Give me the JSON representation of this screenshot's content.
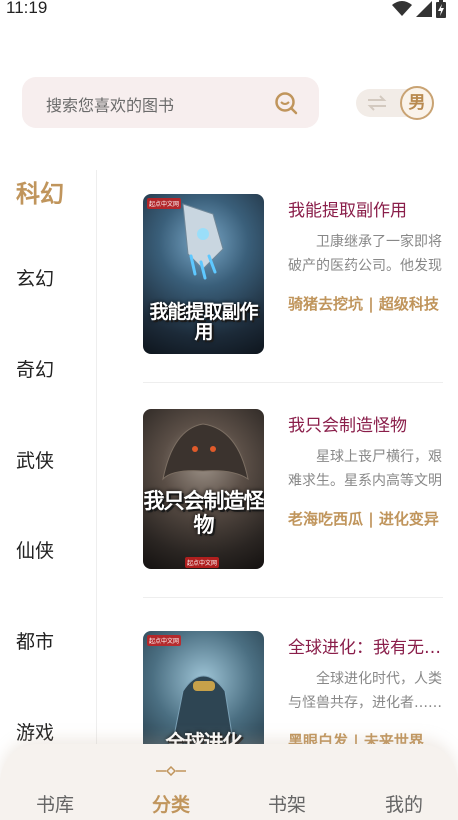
{
  "status": {
    "time": "11:19"
  },
  "search": {
    "placeholder": "搜索您喜欢的图书"
  },
  "gender": {
    "label": "男"
  },
  "categories": [
    "科幻",
    "玄幻",
    "奇幻",
    "武侠",
    "仙侠",
    "都市",
    "游戏"
  ],
  "active_category": "科幻",
  "books": [
    {
      "title": "我能提取副作用",
      "desc": "卫康继承了一家即将破产的医药公司。他发现自己能从药品中提取副作用，并将其转化为特殊能力……",
      "meta": "骑猪去挖坑 | 超级科技",
      "cover_text": "我能提取副作用",
      "cover_pub": "起点中文网"
    },
    {
      "title": "我只会制造怪物",
      "desc": "星球上丧尸横行，艰难求生。星系内高等文明环伺……",
      "meta": "老海吃西瓜 | 进化变异",
      "cover_text": "我只会制造怪物",
      "cover_pub": "起点中文网"
    },
    {
      "title": "全球进化：我有无限天赋",
      "desc": "全球进化时代，人类与怪兽共存，进化者……",
      "meta": "黑眼白发 | 未来世界",
      "cover_text": "全球进化",
      "cover_pub": "起点中文网"
    }
  ],
  "nav": {
    "items": [
      "书库",
      "分类",
      "书架",
      "我的"
    ],
    "active": "分类"
  },
  "colors": {
    "accent": "#c0955c",
    "title": "#8a1e4a",
    "search_bg": "#f7eeee"
  }
}
